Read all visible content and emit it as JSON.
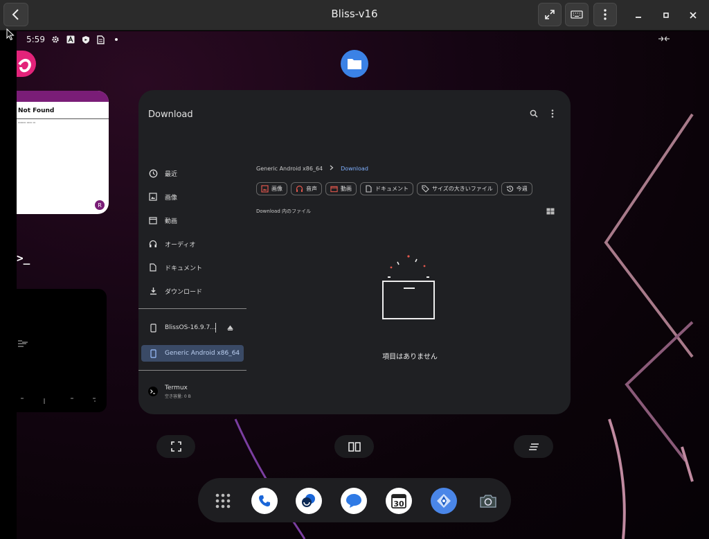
{
  "window": {
    "title": "Bliss-v16",
    "back_icon": "arrow-left-icon",
    "fullscreen_icon": "expand-icon",
    "keyboard_icon": "keyboard-icon",
    "menu_icon": "more-vertical-icon"
  },
  "statusbar": {
    "time": "5:59",
    "icons": [
      "gear-icon",
      "a-icon",
      "shield-icon",
      "sim-icon",
      "dot-icon"
    ]
  },
  "recents": {
    "card1_title": "Not Found",
    "card1_fab": "R"
  },
  "files_app": {
    "title": "Download",
    "nav": [
      {
        "label": "最近",
        "icon": "clock-icon"
      },
      {
        "label": "画像",
        "icon": "image-icon"
      },
      {
        "label": "動画",
        "icon": "video-icon"
      },
      {
        "label": "オーディオ",
        "icon": "headphones-icon"
      },
      {
        "label": "ドキュメント",
        "icon": "document-icon"
      },
      {
        "label": "ダウンロード",
        "icon": "download-icon"
      }
    ],
    "storage": [
      {
        "label": "BlissOS-16.9.7...",
        "icon": "phone-icon"
      },
      {
        "label": "Generic Android x86_64",
        "icon": "phone-icon"
      }
    ],
    "apps": [
      {
        "label": "Termux",
        "sub": "空き容量: 0 B",
        "icon": "terminal-icon"
      }
    ],
    "breadcrumb": {
      "root": "Generic Android x86_64",
      "current": "Download"
    },
    "chips": [
      {
        "label": "画像",
        "icon": "image-icon"
      },
      {
        "label": "音声",
        "icon": "headphones-icon"
      },
      {
        "label": "動画",
        "icon": "video-icon"
      },
      {
        "label": "ドキュメント",
        "icon": "document-icon"
      },
      {
        "label": "サイズの大きいファイル",
        "icon": "tag-icon"
      },
      {
        "label": "今週",
        "icon": "history-icon"
      }
    ],
    "section_label": "Download 内のファイル",
    "empty_text": "項目はありません"
  },
  "dock": {
    "apps": [
      "app-drawer-icon",
      "phone-icon",
      "chat-icon",
      "messages-icon",
      "calendar-icon",
      "maps-icon",
      "camera-icon"
    ],
    "calendar_day": "30"
  },
  "colors": {
    "accent": "#7fb0ff",
    "chip_icon": "#e2574c",
    "selected_nav": "#3a4a66"
  }
}
